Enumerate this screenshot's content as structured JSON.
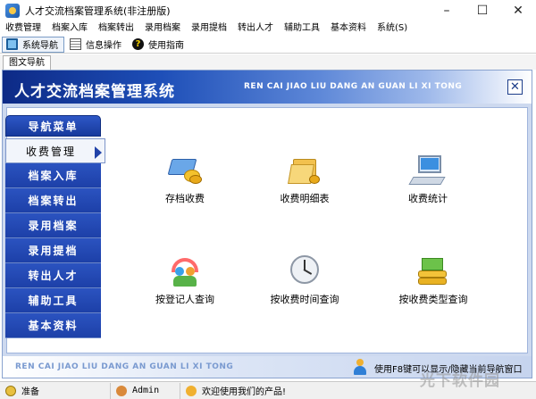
{
  "window": {
    "title": "人才交流档案管理系统(非注册版)",
    "controls": {
      "minimize": "–",
      "maximize": "☐",
      "close": "✕"
    }
  },
  "menu": [
    "收费管理",
    "档案入库",
    "档案转出",
    "录用档案",
    "录用提档",
    "转出人才",
    "辅助工具",
    "基本资料",
    "系统(S)"
  ],
  "toolbar": {
    "items": [
      {
        "label": "系统导航",
        "icon": "monitor-icon"
      },
      {
        "label": "信息操作",
        "icon": "document-icon"
      },
      {
        "label": "使用指南",
        "icon": "help-icon",
        "glyph": "?"
      }
    ]
  },
  "subtab": "图文导航",
  "banner": {
    "title": "人才交流档案管理系统",
    "subtitle": "REN CAI JIAO LIU DANG AN GUAN LI XI TONG",
    "close": "✕"
  },
  "nav": {
    "header": "导航菜单",
    "items": [
      "收费管理",
      "档案入库",
      "档案转出",
      "录用档案",
      "录用提档",
      "转出人才",
      "辅助工具",
      "基本资料"
    ],
    "active_index": 0
  },
  "functions": [
    {
      "label": "存档收费",
      "icon": "card-payment-icon"
    },
    {
      "label": "收费明细表",
      "icon": "folder-coins-icon"
    },
    {
      "label": "收费统计",
      "icon": "computer-icon"
    },
    {
      "label": "按登记人查询",
      "icon": "people-icon"
    },
    {
      "label": "按收费时间查询",
      "icon": "clock-icon"
    },
    {
      "label": "按收费类型查询",
      "icon": "money-stack-icon"
    }
  ],
  "footer": {
    "subtitle": "REN CAI JIAO LIU DANG AN GUAN LI XI TONG",
    "tip": "使用F8键可以显示/隐藏当前导航窗口"
  },
  "status": {
    "ready": "准备",
    "user": "Admin",
    "welcome": "欢迎使用我们的产品!"
  },
  "watermark": "光下软件园",
  "colors": {
    "banner_dark": "#0d2a86",
    "nav_blue": "#1d40a8",
    "frame_bg": "#cdd9ef"
  }
}
